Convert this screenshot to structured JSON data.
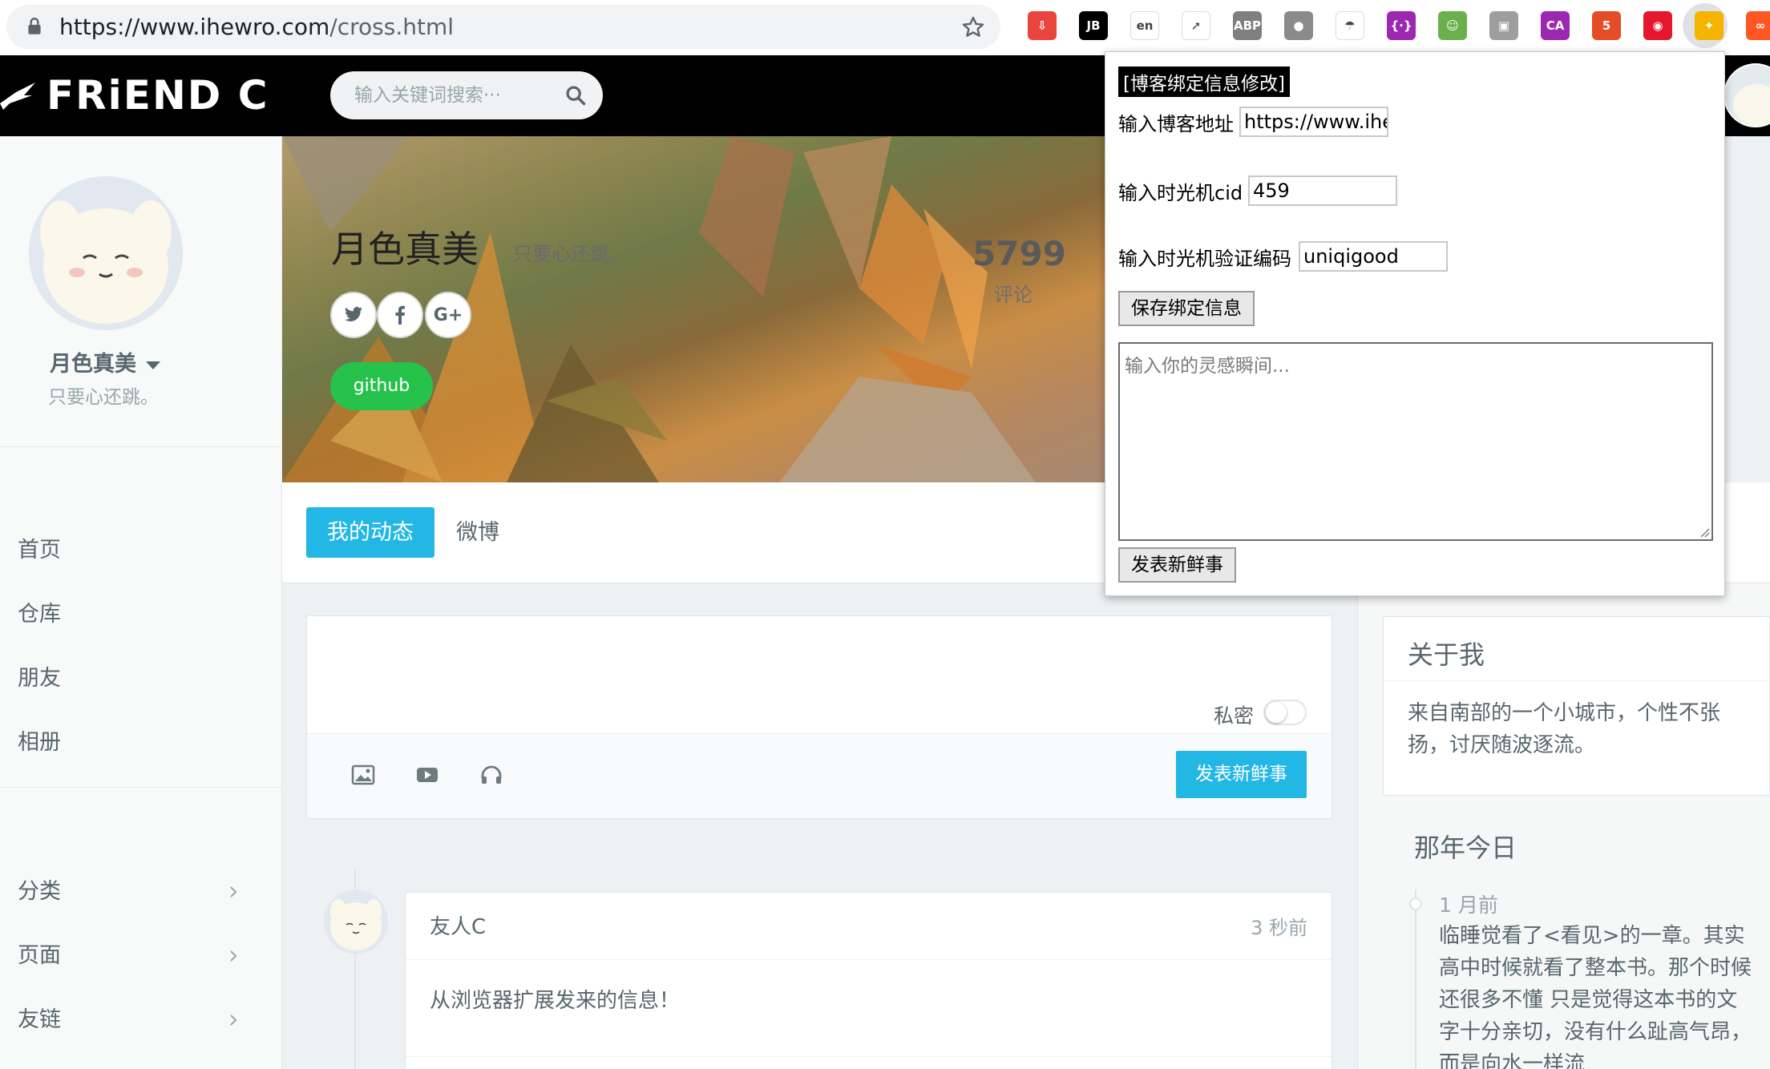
{
  "browser": {
    "url_host": "https://www.ihewro.com",
    "url_path": "/cross.html",
    "extensions": [
      {
        "icon": "download-ext-icon",
        "color": "#e8453c",
        "text": "⇩"
      },
      {
        "icon": "jetbrains-ext-icon",
        "color": "#000000",
        "text": "JB"
      },
      {
        "icon": "translate-ext-icon",
        "color": "#ffffff",
        "text": "en"
      },
      {
        "icon": "compass-ext-icon",
        "color": "#ffffff",
        "text": "➚"
      },
      {
        "icon": "adblock-ext-icon",
        "color": "#7f7f7f",
        "text": "ABP"
      },
      {
        "icon": "circle-ext-icon",
        "color": "#8a8a8a",
        "text": "●"
      },
      {
        "icon": "parachute-ext-icon",
        "color": "#ffffff",
        "text": "☂"
      },
      {
        "icon": "purple-ext-icon",
        "color": "#9c27b0",
        "text": "{·}"
      },
      {
        "icon": "frog-ext-icon",
        "color": "#6ab04c",
        "text": "☺"
      },
      {
        "icon": "image-ext-icon",
        "color": "#9e9e9e",
        "text": "▣"
      },
      {
        "icon": "ca-ext-icon",
        "color": "#9c27b0",
        "text": "CA"
      },
      {
        "icon": "html5-ext-icon",
        "color": "#e44d26",
        "text": "5"
      },
      {
        "icon": "weibo-ext-icon",
        "color": "#e6162d",
        "text": "◉"
      },
      {
        "icon": "pinwheel-ext-icon",
        "color": "#f5b400",
        "text": "✦"
      },
      {
        "icon": "infinity-ext-icon",
        "color": "#ff5722",
        "text": "∞"
      }
    ]
  },
  "header": {
    "logo": "FRiEND C",
    "search_placeholder": "输入关键词搜索···"
  },
  "sidebar": {
    "name": "月色真美",
    "signature": "只要心还跳。",
    "nav": [
      "首页",
      "仓库",
      "朋友",
      "相册"
    ],
    "groups": [
      "分类",
      "页面",
      "友链"
    ]
  },
  "cover": {
    "title": "月色真美",
    "subtitle": "只要心还跳。",
    "stat_number": "5799",
    "stat_label": "评论",
    "social": [
      "twitter",
      "facebook",
      "G+"
    ],
    "github_label": "github"
  },
  "tabs": {
    "active": "我的动态",
    "other": "微博"
  },
  "composer": {
    "private_label": "私密",
    "publish_label": "发表新鲜事"
  },
  "post": {
    "author": "友人C",
    "time": "3 秒前",
    "body": "从浏览器扩展发来的信息！"
  },
  "about": {
    "title": "关于我",
    "body": "来自南部的一个小城市，个性不张扬，讨厌随波逐流。"
  },
  "year_ago": {
    "title": "那年今日",
    "when": "1 月前",
    "text": "临睡觉看了<看见>的一章。其实高中时候就看了整本书。那个时候还很多不懂 只是觉得这本书的文字十分亲切，没有什么趾高气昂，而是向水一样流"
  },
  "popup": {
    "title": "[博客绑定信息修改]",
    "blog_label": "输入博客地址",
    "blog_value": "https://www.ihewro.co",
    "cid_label": "输入时光机cid",
    "cid_value": "459",
    "code_label": "输入时光机验证编码",
    "code_value": "uniqigood",
    "save_label": "保存绑定信息",
    "textarea_placeholder": "输入你的灵感瞬间...",
    "publish_label": "发表新鲜事"
  }
}
